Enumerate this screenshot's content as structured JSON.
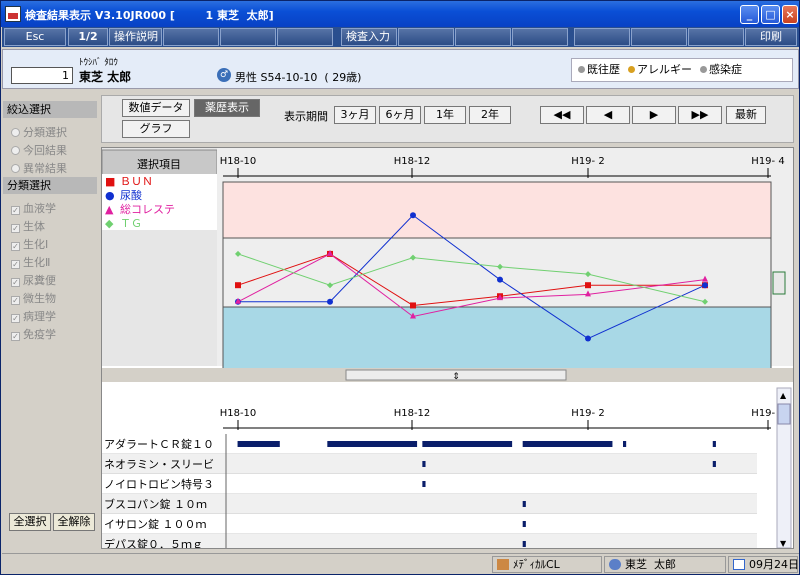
{
  "window": {
    "title": "検査結果表示 V3.10JR000 [        1 東芝  太郎]"
  },
  "toolbar": {
    "esc": "Esc",
    "page": "1/2",
    "manual": "操作説明",
    "exam_input": "検査入力",
    "print": "印刷"
  },
  "patient": {
    "id": "1",
    "kana": "ﾄｳｼﾊﾞ ﾀﾛｳ",
    "name": "東芝  太郎",
    "gender_icon": "male-person-icon",
    "info": "男性 S54-10-10  ( 29歳)",
    "history": [
      "既往歴",
      "アレルギー",
      "感染症"
    ]
  },
  "left": {
    "filter_title": "絞込選択",
    "filters": [
      "分類選択",
      "今回結果",
      "異常結果"
    ],
    "category_title": "分類選択",
    "categories": [
      "血液学",
      "生体",
      "生化Ⅰ",
      "生化Ⅱ",
      "尿糞便",
      "微生物",
      "病理学",
      "免疫学"
    ],
    "select_all": "全選択",
    "deselect_all": "全解除"
  },
  "controls": {
    "numeric": "数値データ",
    "graph": "グラフ",
    "drug_history": "薬歴表示",
    "period_label": "表示期間",
    "periods": [
      "3ヶ月",
      "6ヶ月",
      "1年",
      "2年"
    ],
    "latest": "最新"
  },
  "chart": {
    "select_header": "選択項目",
    "x_labels": [
      "H18-10",
      "H18-12",
      "H19- 2",
      "H19- 4"
    ]
  },
  "chart_data": {
    "type": "line",
    "categories": [
      "H18-10",
      "H18-11",
      "H18-12",
      "H19-1",
      "H19-2",
      "H19-3"
    ],
    "series": [
      {
        "name": "ＢＵＮ",
        "color": "#e01010",
        "marker": "square",
        "values": [
          0.45,
          0.62,
          0.34,
          0.39,
          0.45,
          0.45
        ]
      },
      {
        "name": "尿酸",
        "color": "#1030d0",
        "marker": "circle",
        "values": [
          0.36,
          0.36,
          0.83,
          0.48,
          0.16,
          0.45
        ]
      },
      {
        "name": "総コレステ",
        "color": "#e020a0",
        "marker": "triangle",
        "values": [
          0.36,
          0.62,
          0.28,
          0.38,
          0.4,
          0.48
        ]
      },
      {
        "name": "ＴＧ",
        "color": "#70d070",
        "marker": "diamond",
        "values": [
          0.62,
          0.45,
          0.6,
          0.55,
          0.51,
          0.36
        ]
      }
    ]
  },
  "drugs": {
    "items": [
      {
        "name": "アダラートＣＲ錠１０",
        "bars": [
          [
            0.02,
            0.1
          ],
          [
            0.19,
            0.36
          ],
          [
            0.37,
            0.54
          ],
          [
            0.56,
            0.73
          ],
          [
            0.75,
            0.756
          ],
          [
            0.92,
            0.926
          ]
        ]
      },
      {
        "name": "ネオラミン・スリービ",
        "bars": [
          [
            0.37,
            0.376
          ],
          [
            0.92,
            0.926
          ]
        ]
      },
      {
        "name": "ノイロトロビン特号３",
        "bars": [
          [
            0.37,
            0.376
          ]
        ]
      },
      {
        "name": "ブスコパン錠  １０ｍ",
        "bars": [
          [
            0.56,
            0.566
          ]
        ]
      },
      {
        "name": "イサロン錠  １００ｍ",
        "bars": [
          [
            0.56,
            0.566
          ]
        ]
      },
      {
        "name": "デパス錠０．５ｍｇ",
        "bars": [
          [
            0.56,
            0.566
          ]
        ]
      }
    ]
  },
  "status": {
    "app": "ﾒﾃﾞｨｶﾙCL",
    "user": "東芝  太郎",
    "date": "09月24日"
  }
}
